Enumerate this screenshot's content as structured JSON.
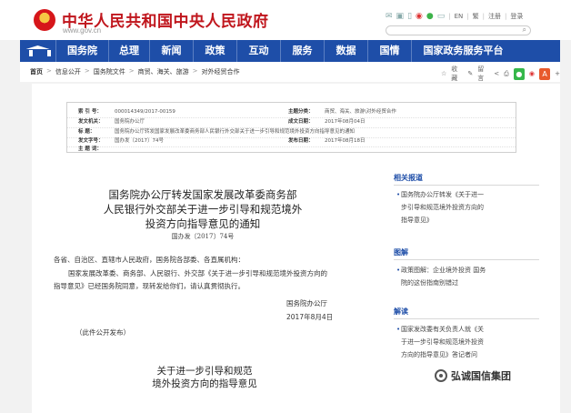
{
  "header": {
    "site_title": "中华人民共和国中央人民政府",
    "site_url": "www.gov.cn",
    "tools": {
      "en_label": "EN",
      "traditional_label": "繁",
      "register_label": "注册",
      "login_label": "登录"
    },
    "search_icon": "magnifier-icon"
  },
  "nav": {
    "items": [
      "国务院",
      "总理",
      "新闻",
      "政策",
      "互动",
      "服务",
      "数据",
      "国情",
      "国家政务服务平台"
    ]
  },
  "breadcrumb": {
    "items": [
      "首页",
      "信息公开",
      "国务院文件",
      "商贸、海关、旅游",
      "对外经贸合作"
    ],
    "actions": {
      "favorite_label": "收藏",
      "comment_label": "留言"
    }
  },
  "meta": {
    "index_key": "索 引 号：",
    "index_val": "000014349/2017-00159",
    "topic_key": "主题分类：",
    "topic_val": "商贸、海关、旅游\\对外经贸合作",
    "issuer_key": "发文机关：",
    "issuer_val": "国务院办公厅",
    "written_key": "成文日期：",
    "written_val": "2017年08月04日",
    "title_key": "标 题：",
    "title_val": "国务院办公厅转发国家发展改革委商务部人民银行外交部关于进一步引导和规范境外投资方向指导意见的通知",
    "docno_key": "发文字号：",
    "docno_val": "国办发〔2017〕74号",
    "publish_key": "发布日期：",
    "publish_val": "2017年08月18日",
    "keywords_key": "主 题 词："
  },
  "article": {
    "title_line1": "国务院办公厅转发国家发展改革委商务部",
    "title_line2": "人民银行外交部关于进一步引导和规范境外",
    "title_line3": "投资方向指导意见的通知",
    "doc_number": "国办发〔2017〕74号",
    "greeting": "各省、自治区、直辖市人民政府，国务院各部委、各直属机构：",
    "body_line1": "国家发展改革委、商务部、人民银行、外交部《关于进一步引导和规范境外投资方向的",
    "body_line2": "指导意见》已经国务院同意，现转发给你们，请认真贯彻执行。",
    "signature": "国务院办公厅",
    "sign_date": "2017年8月4日",
    "note": "（此件公开发布）",
    "subtitle_line1": "关于进一步引导和规范",
    "subtitle_line2": "境外投资方向的指导意见"
  },
  "sidebar": {
    "related_title": "相关报道",
    "related_item_line1": "国务院办公厅转发《关于进一",
    "related_item_line2": "步引导和规范境外投资方向的",
    "related_item_line3": "指导意见》",
    "diagram_title": "图解",
    "diagram_item_line1": "政策图解：企业境外投资 国务",
    "diagram_item_line2": "院的这份指南别错过",
    "reading_title": "解读",
    "reading_item_line1": "国家发改委有关负责人就《关",
    "reading_item_line2": "于进一步引导和规范境外投资",
    "reading_item_line3": "方向的指导意见》答记者问"
  },
  "watermark": {
    "name": "弘诚国信集团"
  }
}
